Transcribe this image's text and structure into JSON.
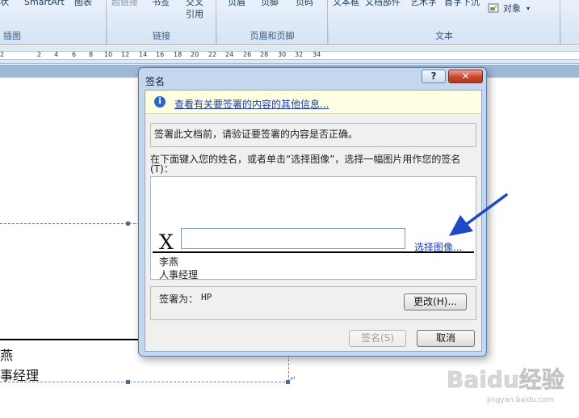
{
  "ribbon": {
    "top_row": [
      "状",
      "SmartArt",
      "图表",
      "超链接",
      "书签",
      "交叉",
      "页眉",
      "页脚",
      "页码",
      "文本框",
      "文档部件",
      "艺术字",
      "首字下沉",
      "对象"
    ],
    "xref_line2": "引用",
    "groups": [
      "插图",
      "链接",
      "页眉和页脚",
      "文本"
    ]
  },
  "ruler": {
    "numbers": [
      "2",
      "2",
      "4",
      "6",
      "8",
      "10",
      "12",
      "14",
      "16",
      "18",
      "20",
      "22",
      "24",
      "26",
      "28",
      "30",
      "32",
      "34"
    ]
  },
  "document": {
    "line1": "燕",
    "line2": "事经理"
  },
  "dialog": {
    "title": "签名",
    "help_label": "?",
    "close_label": "✕",
    "info_icon": "info-icon",
    "info_link": "查看有关要签署的内容的其他信息...",
    "verify_text": "签署此文档前，请验证要签署的内容是否正确。",
    "instruction": "在下面键入您的姓名，或者单击“选择图像”，选择一幅图片用作您的签名(T)：",
    "x_mark": "X",
    "name_value": "",
    "select_image": "选择图像...",
    "signer_name": "李燕",
    "signer_title": "人事经理",
    "sign_as_label": "签署为：",
    "sign_as_value": "HP",
    "change_button": "更改(H)...",
    "sign_button": "签名(S)",
    "cancel_button": "取消"
  },
  "colors": {
    "accent_arrow": "#1f48c4",
    "link": "#1b3fb0",
    "close": "#c9462d"
  },
  "watermark": {
    "brand": "Baidu经验",
    "url": "jingyan.baidu.com"
  }
}
